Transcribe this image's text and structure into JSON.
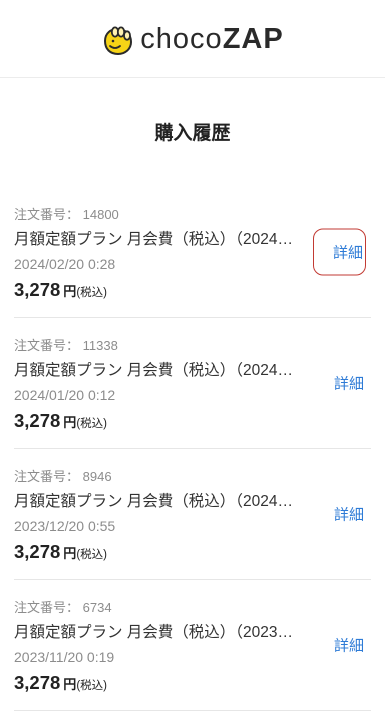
{
  "header": {
    "logo": {
      "icon": "chocozap-hand-icon",
      "text_choco": "choco",
      "text_zap": "ZAP"
    }
  },
  "page_title": "購入履歴",
  "labels": {
    "order_no": "注文番号：",
    "currency": "円",
    "tax_included": "(税込)",
    "details_link": "詳細"
  },
  "purchases": [
    {
      "order_no": "14800",
      "product": "月額定額プラン 月会費（税込）（2024…",
      "date": "2024/02/20 0:28",
      "price": "3,278"
    },
    {
      "order_no": "11338",
      "product": "月額定額プラン 月会費（税込）（2024…",
      "date": "2024/01/20 0:12",
      "price": "3,278"
    },
    {
      "order_no": "8946",
      "product": "月額定額プラン 月会費（税込）（2024…",
      "date": "2023/12/20 0:55",
      "price": "3,278"
    },
    {
      "order_no": "6734",
      "product": "月額定額プラン 月会費（税込）（2023…",
      "date": "2023/11/20 0:19",
      "price": "3,278"
    }
  ],
  "colors": {
    "brand_yellow": "#F6D316",
    "link": "#2E7BD6",
    "highlight": "#C23A33",
    "text": "#333333",
    "muted": "#8C8C8C",
    "divider": "#E6E6E6"
  }
}
